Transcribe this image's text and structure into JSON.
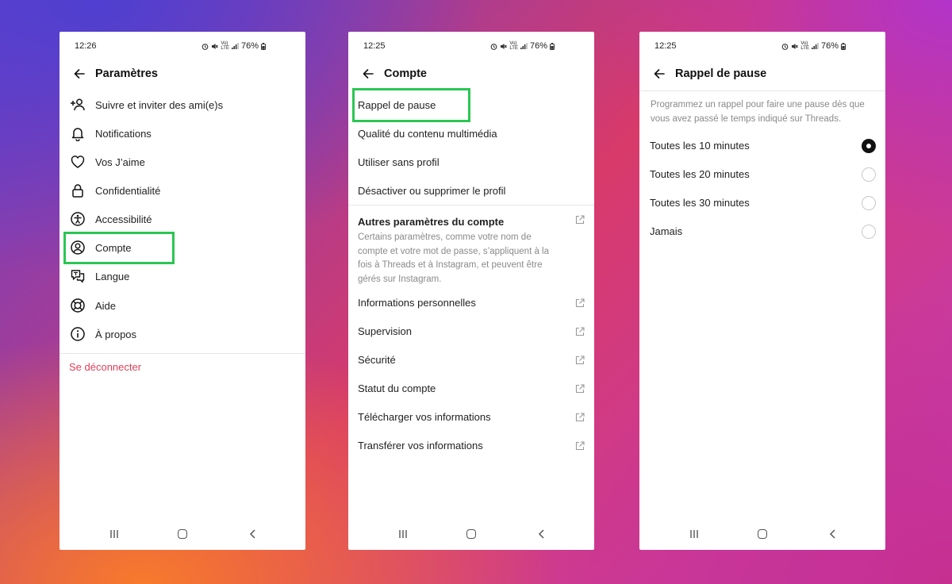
{
  "phones": [
    {
      "status": {
        "time": "12:26",
        "battery": "76%"
      },
      "title": "Paramètres",
      "items": [
        {
          "label": "Suivre et inviter des ami(e)s",
          "icon": "add-friend-icon"
        },
        {
          "label": "Notifications",
          "icon": "bell-icon"
        },
        {
          "label": "Vos J’aime",
          "icon": "heart-icon"
        },
        {
          "label": "Confidentialité",
          "icon": "lock-icon"
        },
        {
          "label": "Accessibilité",
          "icon": "accessibility-icon"
        },
        {
          "label": "Compte",
          "icon": "account-icon"
        },
        {
          "label": "Langue",
          "icon": "language-icon"
        },
        {
          "label": "Aide",
          "icon": "help-lifebuoy-icon"
        },
        {
          "label": "À propos",
          "icon": "info-icon"
        }
      ],
      "logout": "Se déconnecter"
    },
    {
      "status": {
        "time": "12:25",
        "battery": "76%"
      },
      "title": "Compte",
      "items_top": [
        {
          "label": "Rappel de pause"
        },
        {
          "label": "Qualité du contenu multimédia"
        },
        {
          "label": "Utiliser sans profil"
        },
        {
          "label": "Désactiver ou supprimer le profil"
        }
      ],
      "other": {
        "title": "Autres paramètres du compte",
        "description": "Certains paramètres, comme votre nom de compte et votre mot de passe, s’appliquent à la fois à Threads et à Instagram, et peuvent être gérés sur Instagram."
      },
      "items_external": [
        {
          "label": "Informations personnelles"
        },
        {
          "label": "Supervision"
        },
        {
          "label": "Sécurité"
        },
        {
          "label": "Statut du compte"
        },
        {
          "label": "Télécharger vos informations"
        },
        {
          "label": "Transférer vos informations"
        }
      ]
    },
    {
      "status": {
        "time": "12:25",
        "battery": "76%"
      },
      "title": "Rappel de pause",
      "description": "Programmez un rappel pour faire une pause dès que vous avez passé le temps indiqué sur Threads.",
      "options": [
        {
          "label": "Toutes les 10 minutes",
          "selected": true
        },
        {
          "label": "Toutes les 20 minutes",
          "selected": false
        },
        {
          "label": "Toutes les 30 minutes",
          "selected": false
        },
        {
          "label": "Jamais",
          "selected": false
        }
      ]
    }
  ],
  "colors": {
    "highlight": "#2bc653",
    "logout": "#e0405a"
  }
}
